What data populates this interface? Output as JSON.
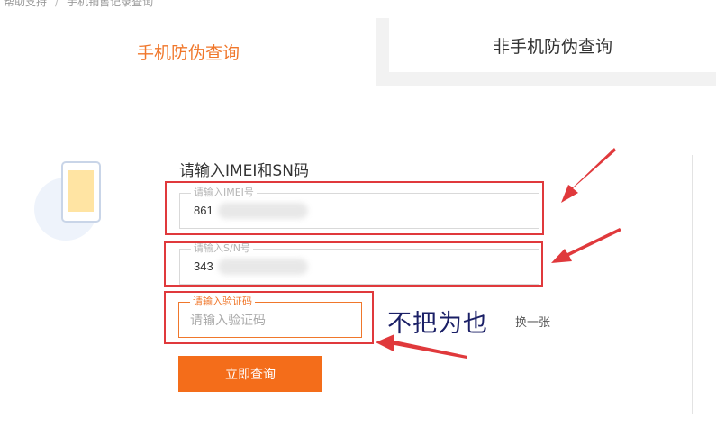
{
  "breadcrumb": {
    "item1": "帮助支持",
    "separator": "/",
    "item2": "手机销售记录查询"
  },
  "tabs": [
    {
      "label": "手机防伪查询",
      "active": true
    },
    {
      "label": "非手机防伪查询",
      "active": false
    }
  ],
  "form": {
    "title": "请输入IMEI和SN码",
    "imei": {
      "legend": "请输入IMEI号",
      "value": "861"
    },
    "sn": {
      "legend": "请输入S/N号",
      "value": "343"
    },
    "captcha": {
      "legend": "请输入验证码",
      "placeholder": "请输入验证码",
      "value": ""
    },
    "captcha_image_text": "不把为也",
    "refresh_label": "换一张",
    "submit_label": "立即查询"
  },
  "colors": {
    "accent": "#f0772b",
    "button": "#f46d1a",
    "annotation": "#e0393c"
  },
  "icons": [
    "phone-icon"
  ]
}
